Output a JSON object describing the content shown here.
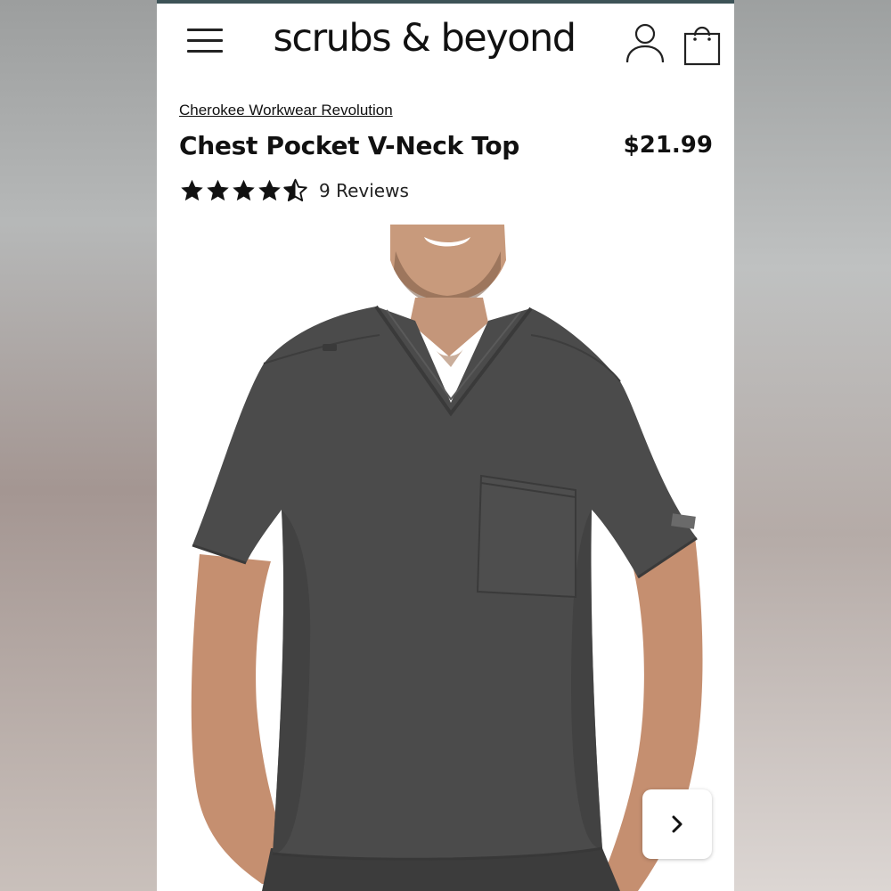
{
  "header": {
    "logo": "scrubs & beyond",
    "menu_icon": "hamburger-menu-icon",
    "account_icon": "user-account-icon",
    "cart_icon": "shopping-bag-icon"
  },
  "product": {
    "brand": "Cherokee Workwear Revolution",
    "title": "Chest Pocket V-Neck Top",
    "price": "$21.99",
    "rating": 4.5,
    "rating_max": 5,
    "reviews_label": "9 Reviews"
  },
  "gallery": {
    "image_subject": "model wearing gray v-neck scrub top",
    "next_icon": "chevron-right-icon"
  },
  "colors": {
    "accent_bar": "#3d5357",
    "garment": "#4c4c4c",
    "text": "#111111"
  }
}
